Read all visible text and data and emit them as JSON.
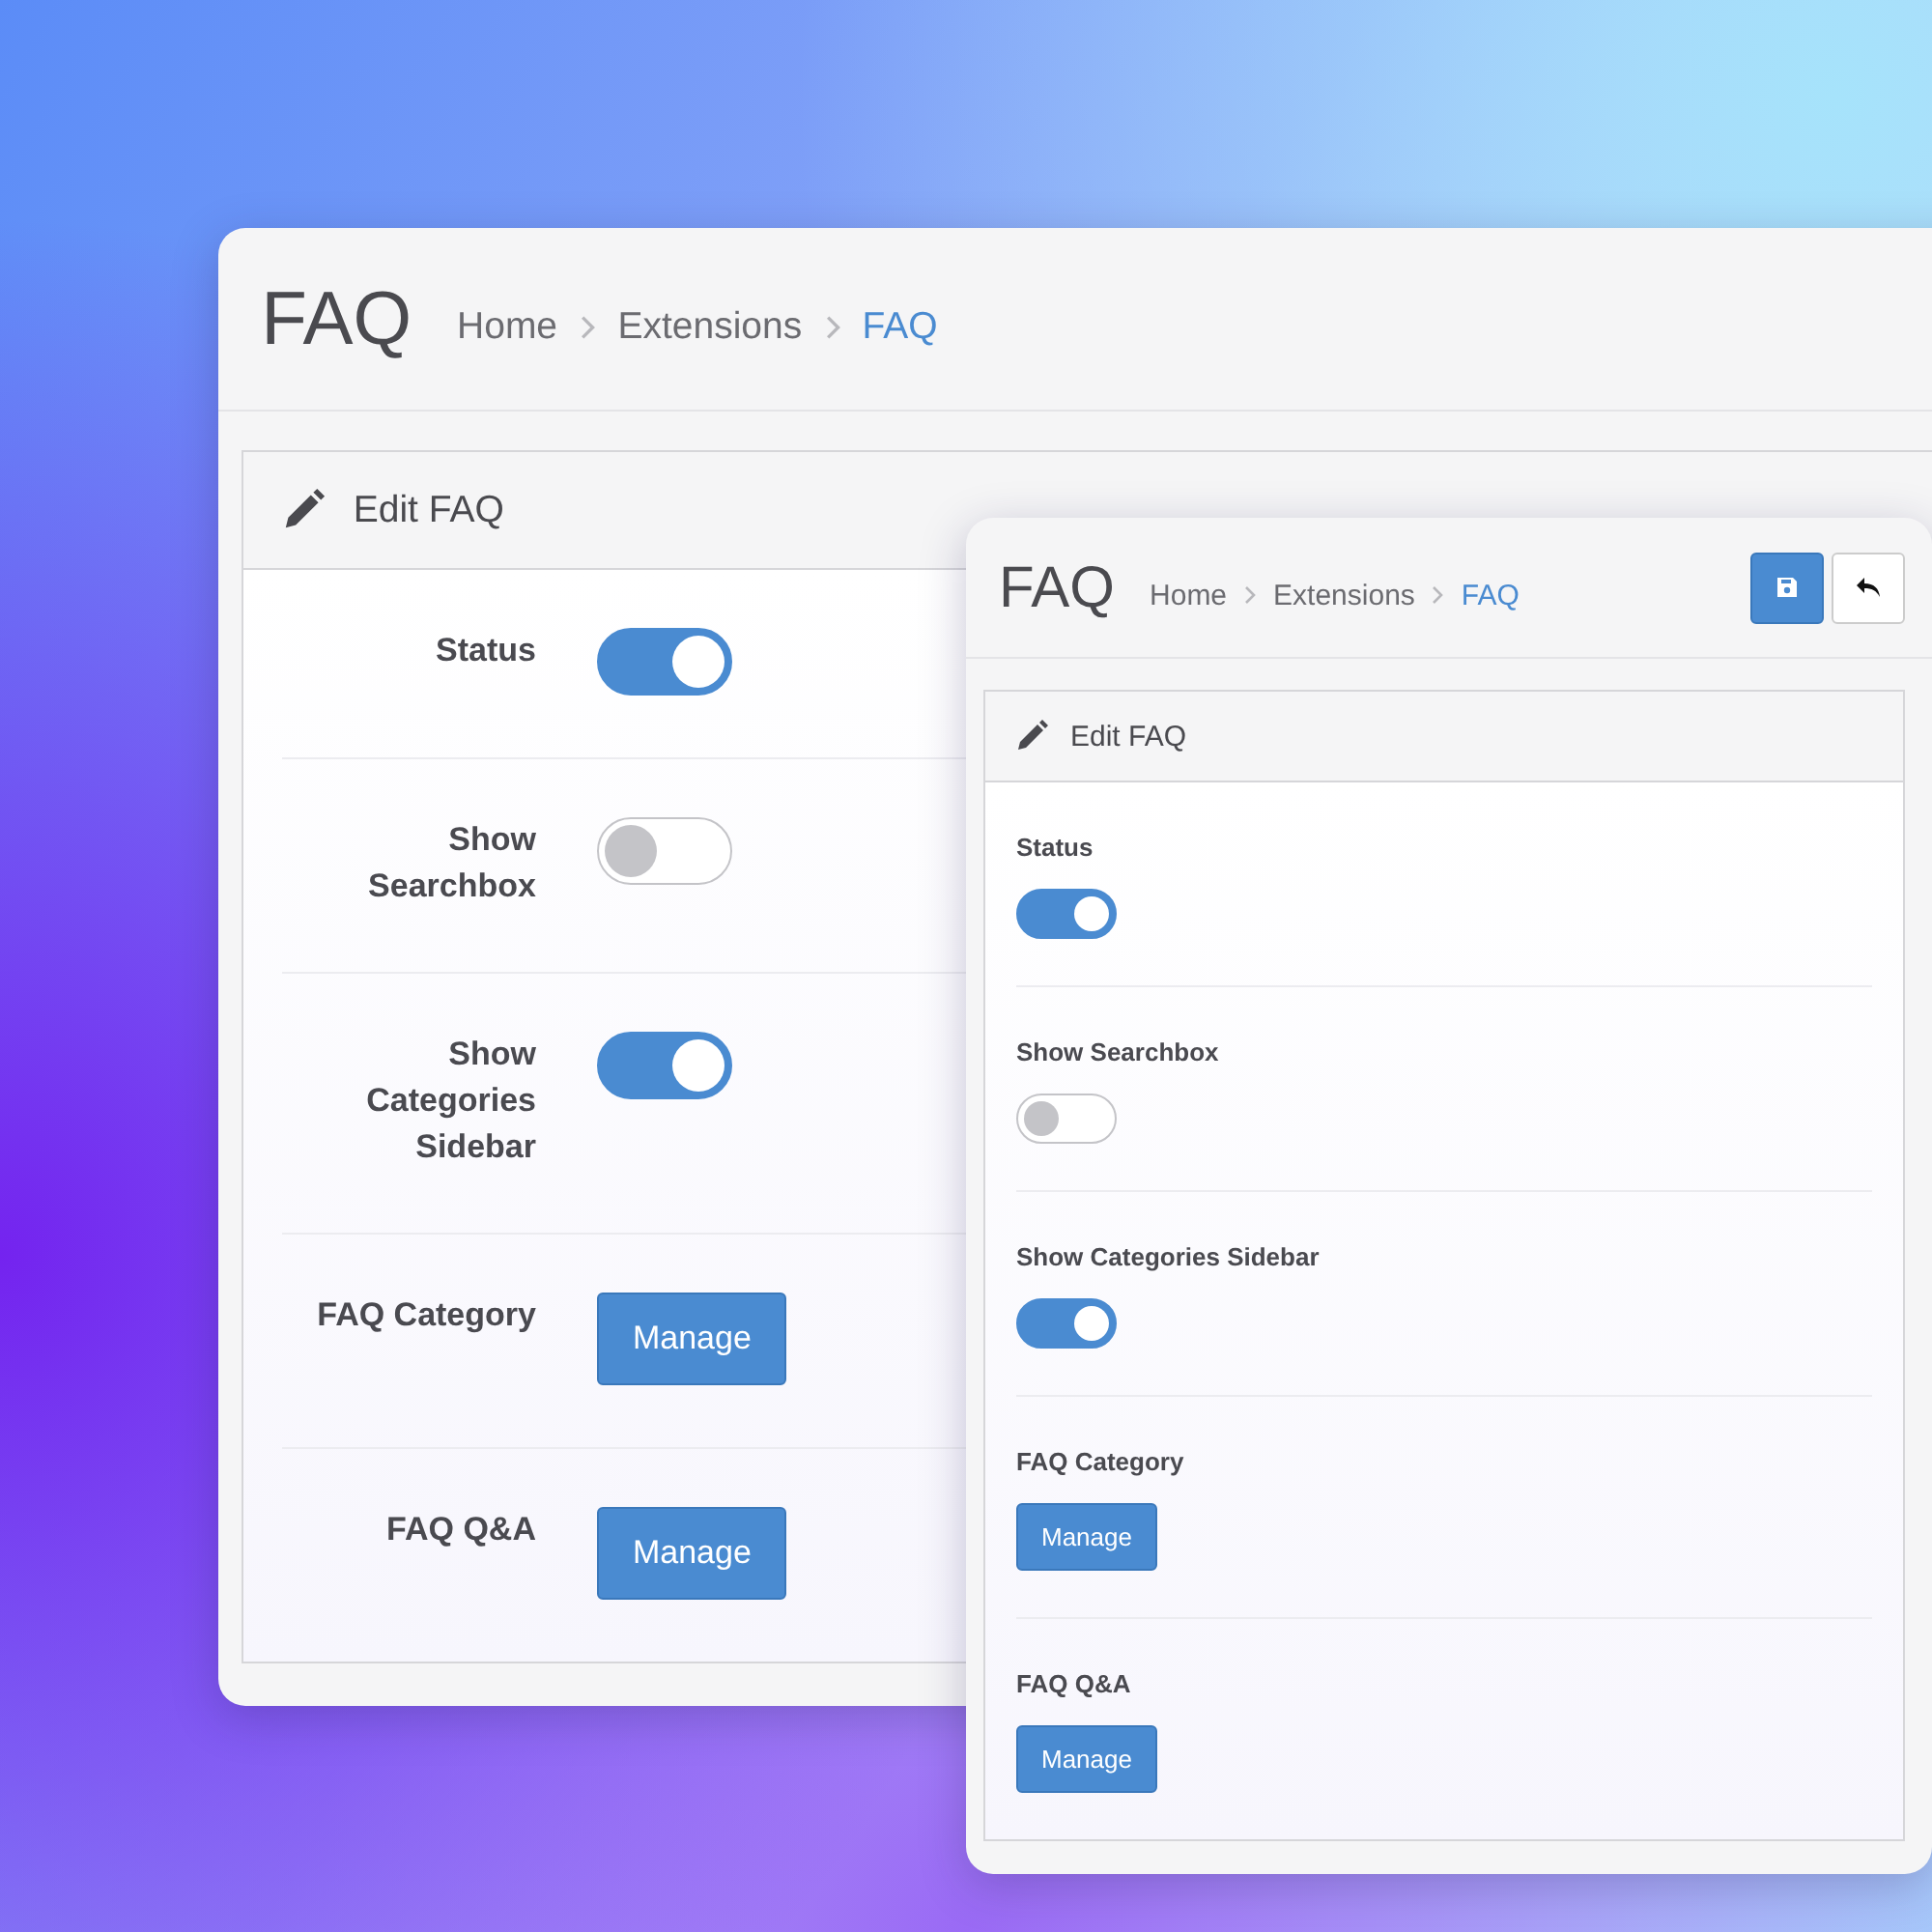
{
  "back_window": {
    "title": "FAQ",
    "breadcrumbs": [
      {
        "label": "Home",
        "active": false
      },
      {
        "label": "Extensions",
        "active": false
      },
      {
        "label": "FAQ",
        "active": true
      }
    ],
    "panel_title": "Edit FAQ",
    "settings": [
      {
        "kind": "toggle",
        "label": "Status",
        "on": true
      },
      {
        "kind": "toggle",
        "label": "Show Searchbox",
        "on": false
      },
      {
        "kind": "toggle",
        "label": "Show Categories Sidebar",
        "on": true
      },
      {
        "kind": "button",
        "label": "FAQ Category",
        "button": "Manage"
      },
      {
        "kind": "button",
        "label": "FAQ Q&A",
        "button": "Manage"
      }
    ]
  },
  "front_window": {
    "title": "FAQ",
    "breadcrumbs": [
      {
        "label": "Home",
        "active": false
      },
      {
        "label": "Extensions",
        "active": false
      },
      {
        "label": "FAQ",
        "active": true
      }
    ],
    "panel_title": "Edit FAQ",
    "settings": [
      {
        "kind": "toggle",
        "label": "Status",
        "on": true
      },
      {
        "kind": "toggle",
        "label": "Show Searchbox",
        "on": false
      },
      {
        "kind": "toggle",
        "label": "Show Categories Sidebar",
        "on": true
      },
      {
        "kind": "button",
        "label": "FAQ Category",
        "button": "Manage"
      },
      {
        "kind": "button",
        "label": "FAQ Q&A",
        "button": "Manage"
      }
    ]
  }
}
